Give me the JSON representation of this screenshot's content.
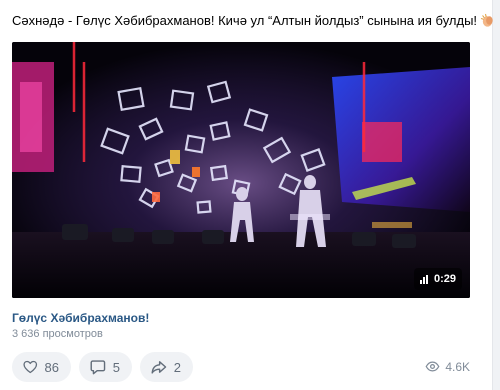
{
  "post": {
    "text": "Сәхнәдә - Гөлүс Хәбибрахманов! Кичә ул “Алтын йолдыз” сынына ия булды!",
    "emoji_icon": "clapping-hands-icon"
  },
  "video": {
    "duration": "0:29",
    "title": "Гөлүс Хәбибрахманов!",
    "views": "3 636 просмотров"
  },
  "actions": {
    "likes": "86",
    "comments": "5",
    "shares": "2",
    "views": "4.6K"
  },
  "colors": {
    "link": "#2a5885",
    "muted": "#818c99",
    "button_bg": "#f0f2f5",
    "icon": "#626d7a"
  }
}
